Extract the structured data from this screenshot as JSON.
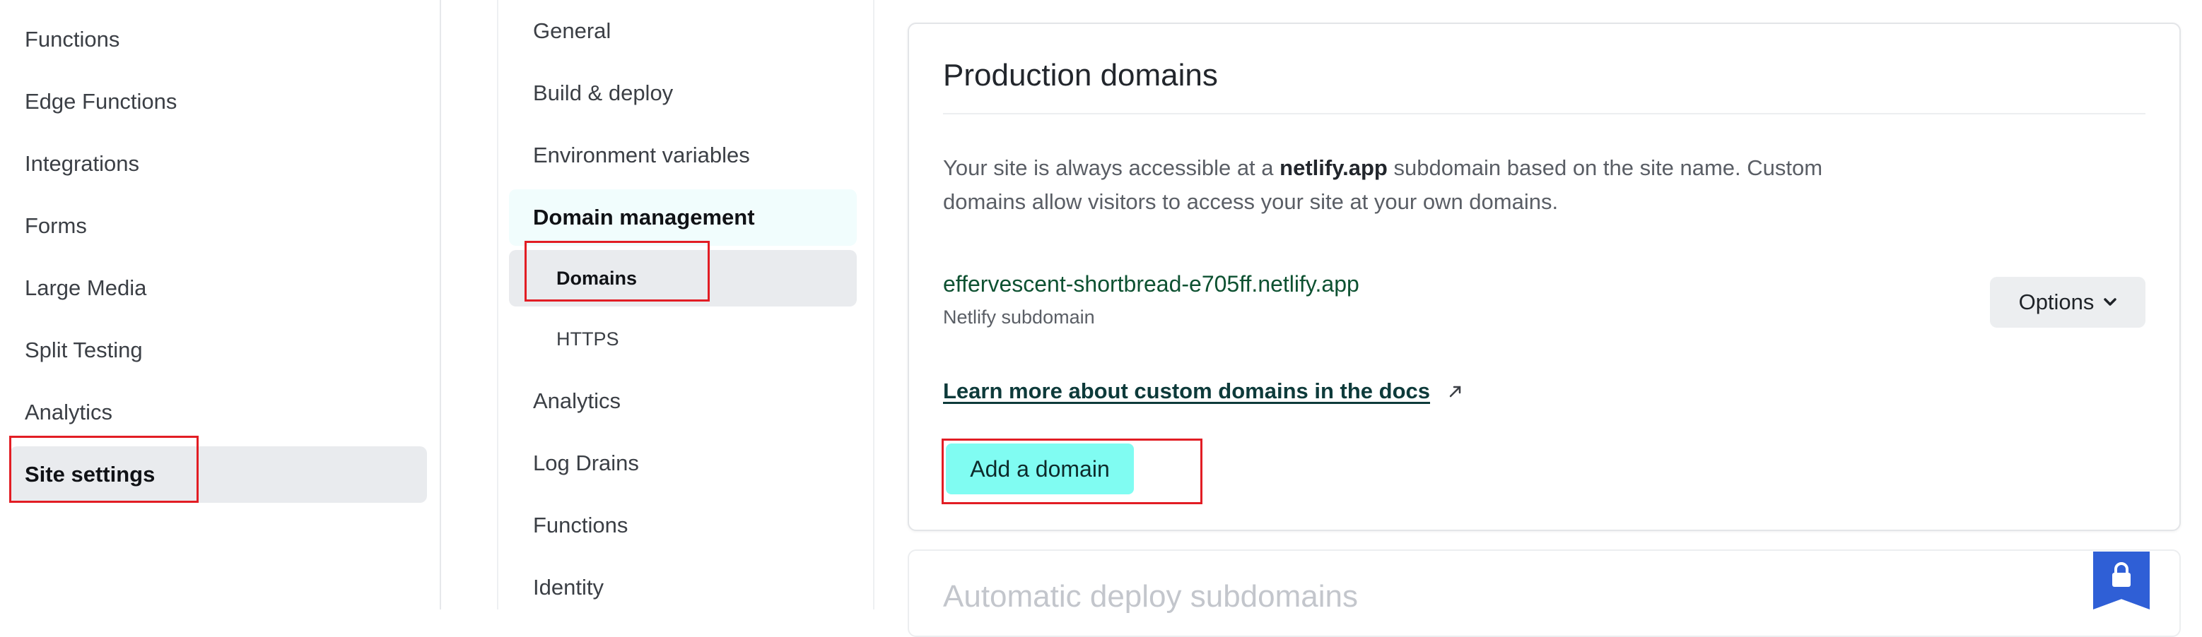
{
  "left_nav": {
    "items": [
      {
        "label": "Functions"
      },
      {
        "label": "Edge Functions"
      },
      {
        "label": "Integrations"
      },
      {
        "label": "Forms"
      },
      {
        "label": "Large Media"
      },
      {
        "label": "Split Testing"
      },
      {
        "label": "Analytics"
      },
      {
        "label": "Site settings",
        "active": true
      }
    ]
  },
  "settings_nav": {
    "items": [
      {
        "label": "General"
      },
      {
        "label": "Build & deploy"
      },
      {
        "label": "Environment variables"
      },
      {
        "label": "Domain management",
        "section": true
      },
      {
        "label": "Analytics"
      },
      {
        "label": "Log Drains"
      },
      {
        "label": "Functions"
      },
      {
        "label": "Identity"
      }
    ],
    "sub_items": [
      {
        "label": "Domains",
        "active": true
      },
      {
        "label": "HTTPS"
      }
    ]
  },
  "production_domains": {
    "title": "Production domains",
    "description_part1": "Your site is always accessible at a ",
    "description_bold": "netlify.app",
    "description_part2": " subdomain based on the site name. Custom domains allow visitors to access your site at your own domains.",
    "domain": {
      "name": "effervescent-shortbread-e705ff.netlify.app",
      "type": "Netlify subdomain",
      "options_label": "Options"
    },
    "docs_link": "Learn more about custom domains in the docs",
    "add_domain_label": "Add a domain"
  },
  "next_section": {
    "title": "Automatic deploy subdomains"
  },
  "icons": {
    "external_link": "external-link-icon",
    "options_chevron": "chevron-down-icon",
    "lock": "lock-icon"
  },
  "colors": {
    "accent_button": "#80fcf2",
    "domain_text": "#0d5131",
    "highlight_box": "#e21d24",
    "lock_badge": "#2f5fd6"
  }
}
